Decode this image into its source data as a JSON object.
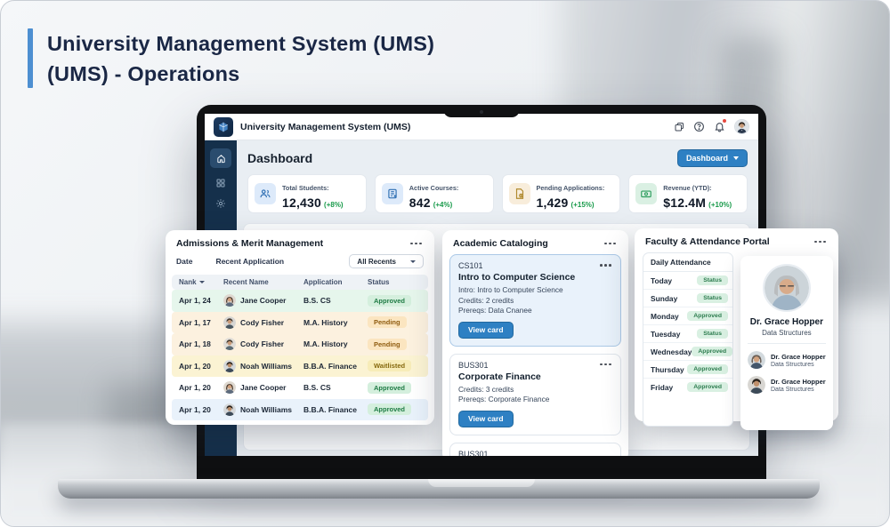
{
  "hero": {
    "line1": "University Management System (UMS)",
    "line2": "(UMS) - Operations"
  },
  "screen": {
    "topbar": {
      "title": "University Management System (UMS)"
    },
    "header": {
      "title": "Dashboard",
      "nav_button": "Dashboard"
    },
    "stats": [
      {
        "label": "Total Students:",
        "value": "12,430",
        "delta": "(+8%)",
        "icon": "users-icon"
      },
      {
        "label": "Active Courses:",
        "value": "842",
        "delta": "(+4%)",
        "icon": "book-icon"
      },
      {
        "label": "Pending Applications:",
        "value": "1,429",
        "delta": "(+15%)",
        "icon": "document-clock-icon"
      },
      {
        "label": "Revenue (YTD):",
        "value": "$12.4M",
        "delta": "(+10%)",
        "icon": "cash-icon"
      }
    ]
  },
  "admissions": {
    "title": "Admissions & Merit Management",
    "filters": [
      "Date",
      "Recent Application"
    ],
    "dropdown": "All Recents",
    "columns": [
      "Nank",
      "Recent Name",
      "Application",
      "Status"
    ],
    "rows": [
      {
        "date": "Apr 1, 24",
        "name": "Jane Cooper",
        "application": "B.S. CS",
        "status": "Approved"
      },
      {
        "date": "Apr 1, 17",
        "name": "Cody Fisher",
        "application": "M.A. History",
        "status": "Pending"
      },
      {
        "date": "Apr 1, 18",
        "name": "Cody Fisher",
        "application": "M.A. History",
        "status": "Pending"
      },
      {
        "date": "Apr 1, 20",
        "name": "Noah Williams",
        "application": "B.B.A. Finance",
        "status": "Waitlisted"
      },
      {
        "date": "Apr 1, 20",
        "name": "Jane Cooper",
        "application": "B.S. CS",
        "status": "Approved"
      },
      {
        "date": "Apr 1, 20",
        "name": "Noah Williams",
        "application": "B.B.A. Finance",
        "status": "Approved"
      }
    ]
  },
  "catalog": {
    "title": "Academic Cataloging",
    "cards": [
      {
        "code": "CS101",
        "name": "Intro to Computer Science",
        "lines": [
          "Intro: Intro to Computer Science",
          "Credits: 2 credits",
          "Prereqs: Data Cnanee"
        ],
        "button": "View card"
      },
      {
        "code": "BUS301",
        "name": "Corporate Finance",
        "lines": [
          "Credits: 3 credits",
          "Prereqs: Corporate Finance"
        ],
        "button": "View card"
      }
    ],
    "partial_code": "BUS301"
  },
  "faculty": {
    "title": "Faculty & Attendance Portal",
    "attendance": {
      "header": "Daily Attendance",
      "rows": [
        {
          "day": "Today",
          "status": "Status"
        },
        {
          "day": "Sunday",
          "status": "Status"
        },
        {
          "day": "Monday",
          "status": "Approved"
        },
        {
          "day": "Tuesday",
          "status": "Status"
        },
        {
          "day": "Wednesday",
          "status": "Approved"
        },
        {
          "day": "Thursday",
          "status": "Approved"
        },
        {
          "day": "Friday",
          "status": "Approved"
        }
      ]
    },
    "profile": {
      "name": "Dr. Grace Hopper",
      "subject": "Data Structures",
      "list": [
        {
          "name": "Dr. Grace Hopper",
          "subject": "Data Structures"
        },
        {
          "name": "Dr. Grace Hopper",
          "subject": "Data Structures"
        }
      ]
    }
  },
  "icons": [
    "logo-cube-icon",
    "window-icon",
    "help-icon",
    "bell-icon",
    "home-icon",
    "grid-icon",
    "gear-icon",
    "users-icon",
    "book-icon",
    "document-clock-icon",
    "cash-icon",
    "chevron-down-icon",
    "more-options-icon",
    "sort-chevron-icon"
  ],
  "colors": {
    "accent_blue": "#2e80c3",
    "navy_title": "#1a2745",
    "sidebar_navy": "#15304b",
    "approved_green": "#1e7b44",
    "pending_amber": "#8f5c10",
    "waitlisted_yellow": "#86690f",
    "delta_green": "#189a4a",
    "notification_red": "#e6493f"
  }
}
